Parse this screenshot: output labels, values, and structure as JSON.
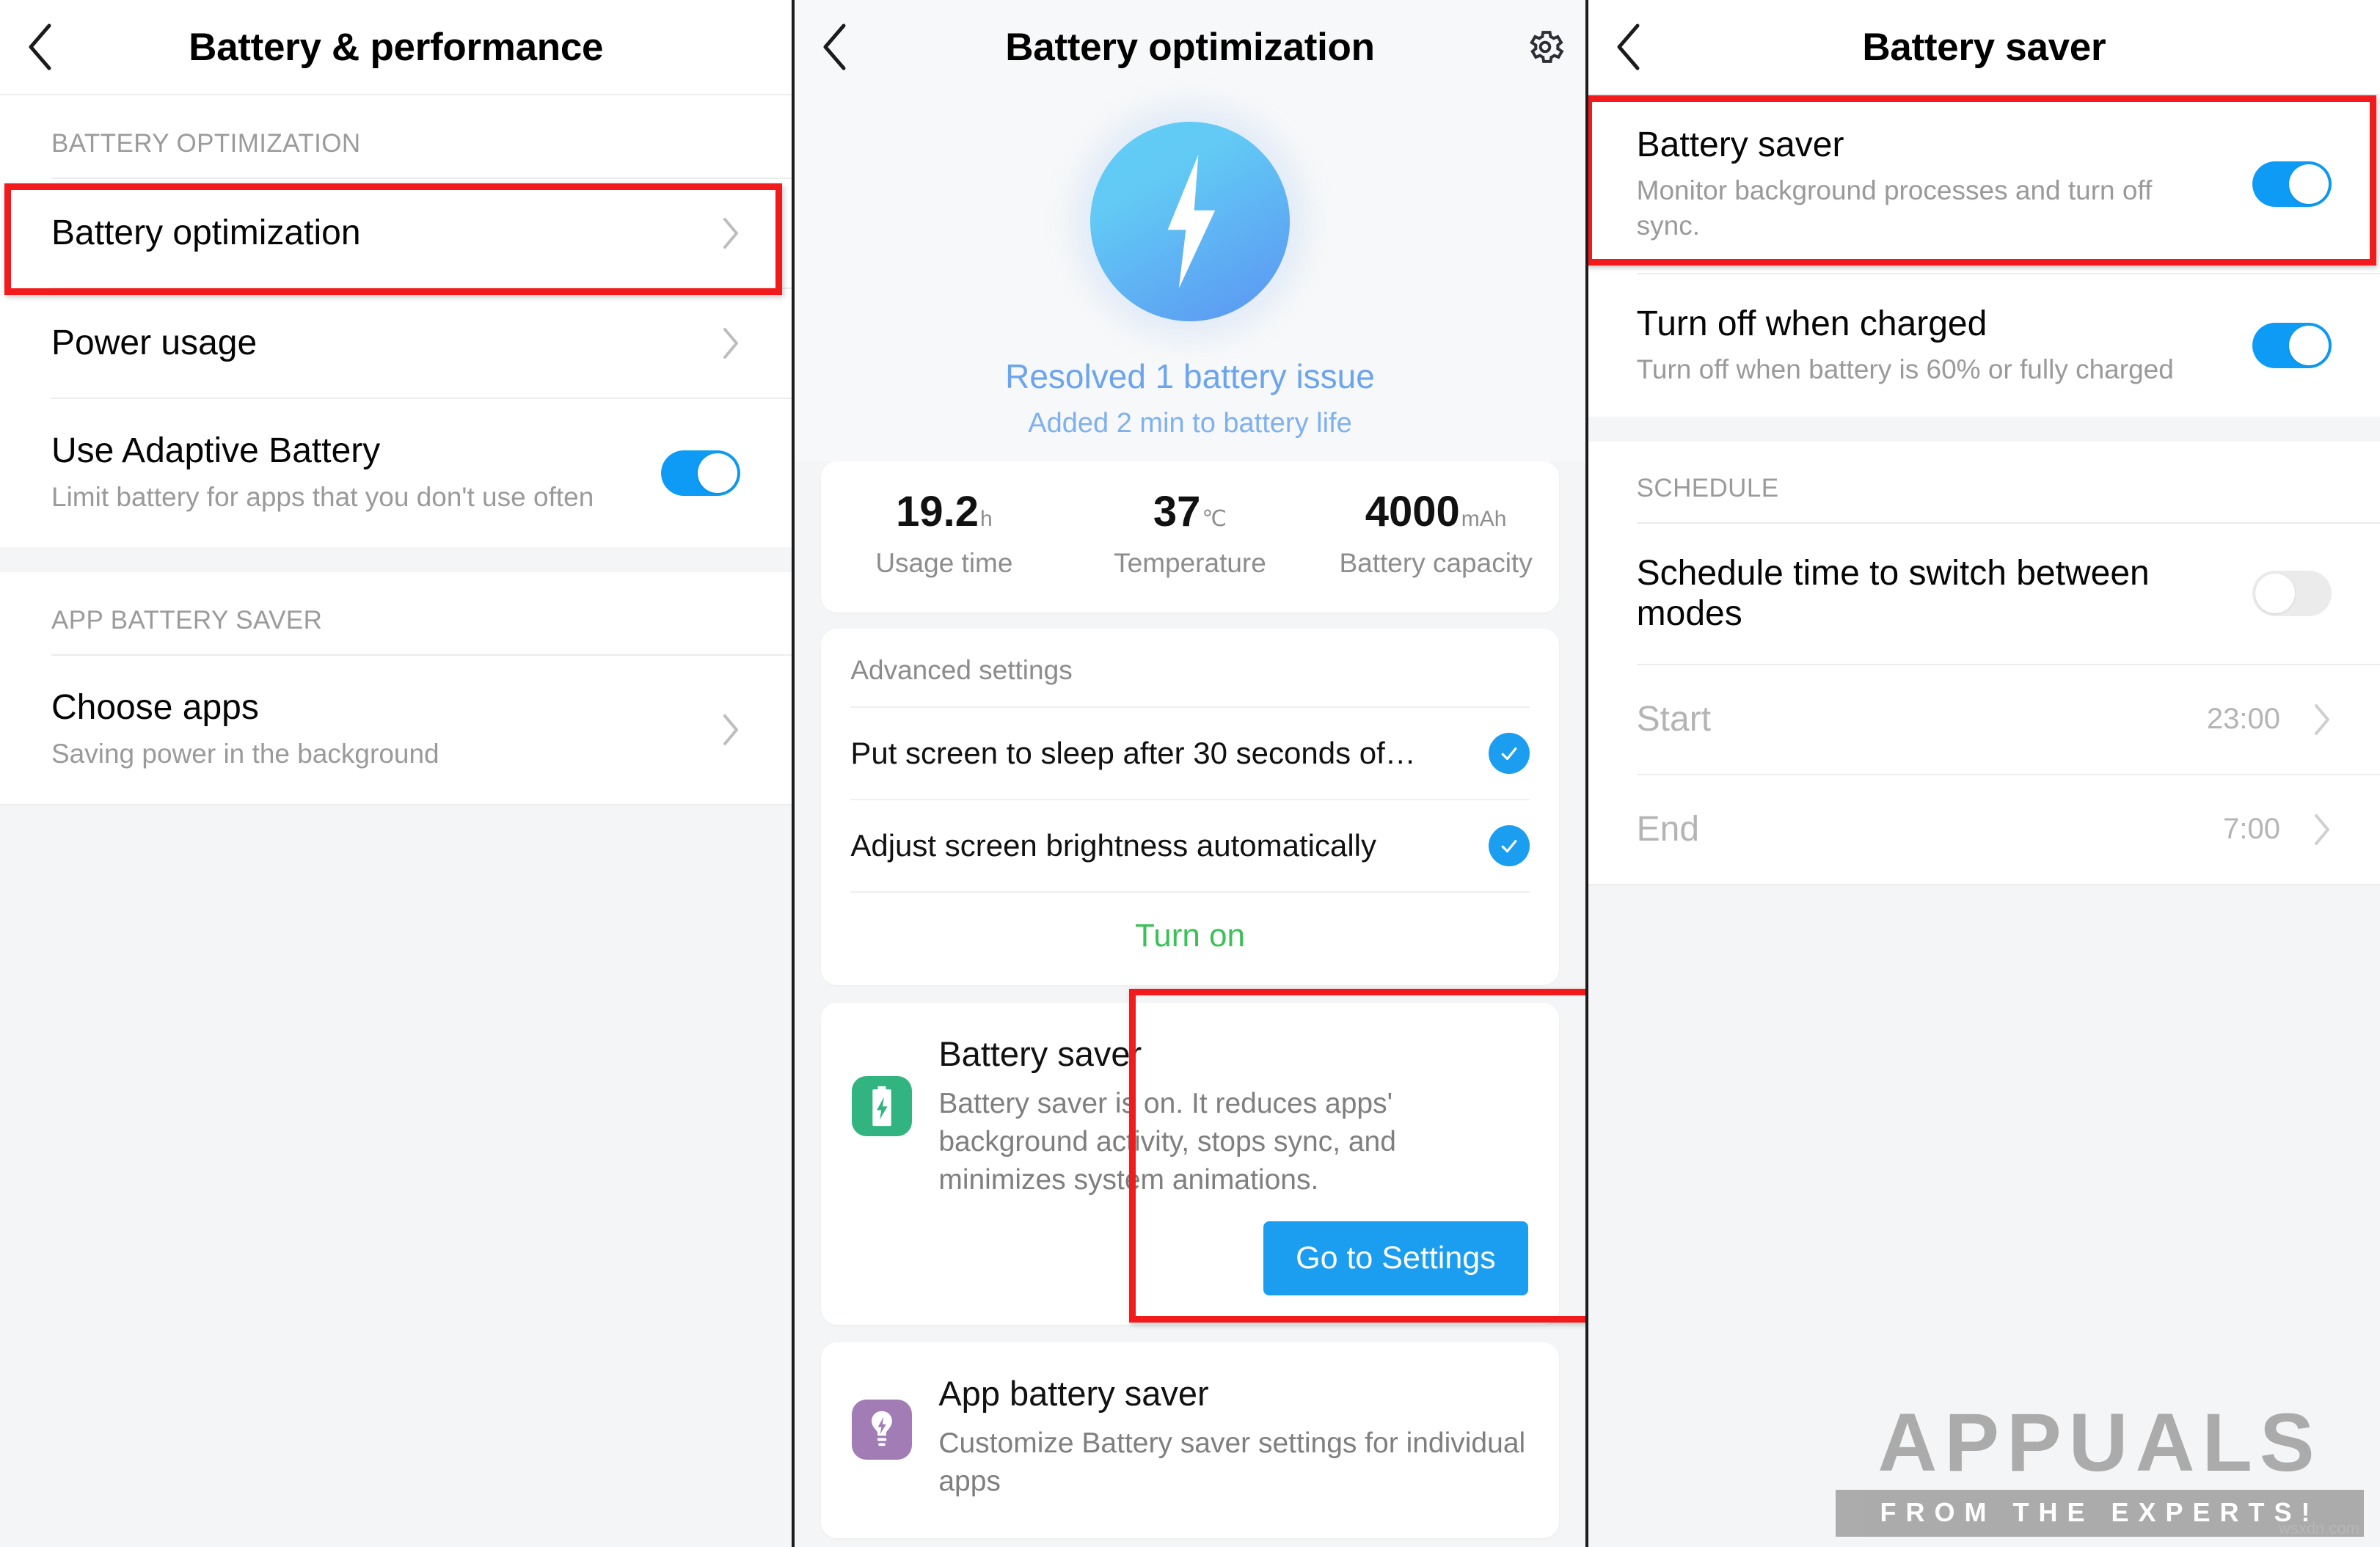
{
  "panel_left": {
    "header": {
      "title": "Battery & performance",
      "back_icon": "chevron-left-icon"
    },
    "section_label": "BATTERY OPTIMIZATION",
    "rows": [
      {
        "title": "Battery optimization",
        "sub": "",
        "type": "chevron",
        "highlighted": true
      },
      {
        "title": "Power usage",
        "sub": "",
        "type": "chevron",
        "highlighted": false
      },
      {
        "title": "Use Adaptive Battery",
        "sub": "Limit battery for apps that you don't use often",
        "type": "toggle",
        "toggle_on": true
      }
    ],
    "section_label2": "APP BATTERY SAVER",
    "rows2": [
      {
        "title": "Choose apps",
        "sub": "Saving power in the background",
        "type": "chevron"
      }
    ]
  },
  "panel_mid": {
    "header": {
      "title": "Battery optimization",
      "back_icon": "chevron-left-icon",
      "gear_icon": "gear-icon"
    },
    "hero": {
      "icon": "lightning-bolt-icon",
      "line1": "Resolved 1 battery issue",
      "line2": "Added 2 min  to battery life"
    },
    "stats": [
      {
        "value": "19.2",
        "unit": "h",
        "label": "Usage time"
      },
      {
        "value": "37",
        "unit": "℃",
        "label": "Temperature"
      },
      {
        "value": "4000",
        "unit": "mAh",
        "label": "Battery capacity"
      }
    ],
    "advanced": {
      "heading": "Advanced settings",
      "items": [
        {
          "label": "Put screen to sleep after 30 seconds of…",
          "checked": true
        },
        {
          "label": "Adjust screen brightness automatically",
          "checked": true
        }
      ],
      "action": "Turn on"
    },
    "battery_saver_card": {
      "icon": "battery-bolt-icon",
      "title": "Battery saver",
      "desc": "Battery saver is on. It reduces apps' background activity, stops sync, and minimizes system animations.",
      "button": "Go to Settings",
      "highlighted": true
    },
    "app_battery_saver_card": {
      "icon": "bulb-bolt-icon",
      "title": "App battery saver",
      "desc": "Customize Battery saver settings for individual apps"
    }
  },
  "panel_right": {
    "header": {
      "title": "Battery saver",
      "back_icon": "chevron-left-icon"
    },
    "rows": [
      {
        "title": "Battery saver",
        "sub": "Monitor background processes and turn off sync.",
        "toggle_on": true,
        "highlighted": true
      },
      {
        "title": "Turn off when charged",
        "sub": "Turn off when battery is 60% or fully charged",
        "toggle_on": true,
        "highlighted": false
      }
    ],
    "section_label": "SCHEDULE",
    "schedule": {
      "toggle_row": {
        "title": "Schedule time to switch between modes",
        "toggle_on": false
      },
      "times": [
        {
          "label": "Start",
          "value": "23:00"
        },
        {
          "label": "End",
          "value": "7:00"
        }
      ]
    }
  },
  "watermark": {
    "main": "APPUALS",
    "sub": "FROM THE EXPERTS!",
    "credit": "wsxdn.com"
  },
  "colors": {
    "accent_blue": "#0d9bf5",
    "check_blue": "#1b9df0",
    "highlight_red": "#f21a1a",
    "green_action": "#3cc058",
    "icon_green": "#31b47f",
    "icon_purple": "#a17cb5",
    "hero_text_blue": "#6ba4ef"
  }
}
